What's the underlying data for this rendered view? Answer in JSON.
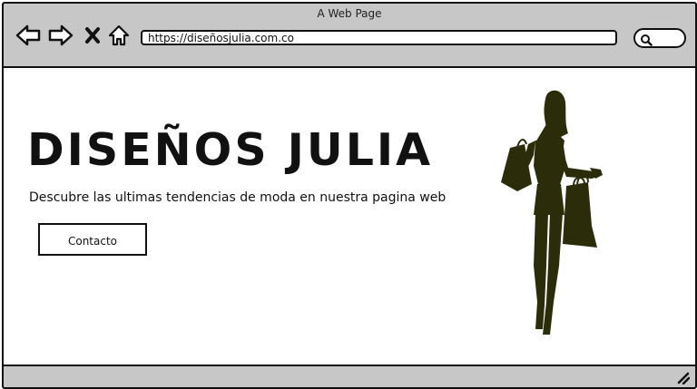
{
  "window": {
    "title": "A Web Page"
  },
  "toolbar": {
    "url": "https://diseñosjulia.com.co"
  },
  "main": {
    "headline": "DISEÑOS JULIA",
    "tagline": "Descubre las ultimas tendencias de moda en nuestra pagina web",
    "contact_label": "Contacto"
  },
  "colors": {
    "chrome": "#c7c7c7",
    "silhouette": "#2b2d0a",
    "stroke": "#111111"
  }
}
